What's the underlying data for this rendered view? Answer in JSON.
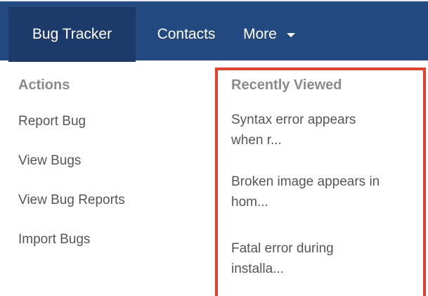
{
  "nav": {
    "tabs": [
      {
        "label": "Bug Tracker",
        "active": true
      },
      {
        "label": "Contacts",
        "active": false
      },
      {
        "label": "More",
        "active": false
      }
    ]
  },
  "actions": {
    "heading": "Actions",
    "items": [
      {
        "label": "Report Bug"
      },
      {
        "label": "View Bugs"
      },
      {
        "label": "View Bug Reports"
      },
      {
        "label": "Import Bugs"
      }
    ]
  },
  "recently_viewed": {
    "heading": "Recently Viewed",
    "items": [
      {
        "line1": "Syntax error appears",
        "line2": "when r..."
      },
      {
        "line1": "Broken image appears in",
        "line2": "hom..."
      },
      {
        "line1": "Fatal error during",
        "line2": "installa..."
      }
    ]
  },
  "colors": {
    "navbar": "#234981",
    "active_tab": "#1c3b6b",
    "highlight": "#e8402a",
    "heading_text": "#8a8a8a",
    "item_text": "#555555"
  }
}
